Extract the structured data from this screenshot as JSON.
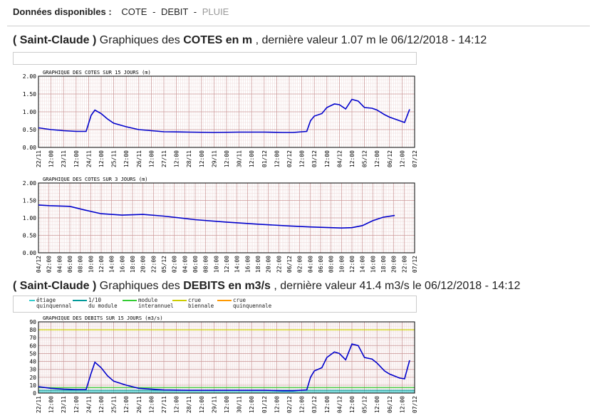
{
  "top": {
    "label": "Données disponibles :",
    "links": [
      {
        "text": "COTE",
        "enabled": true
      },
      {
        "text": "DEBIT",
        "enabled": true
      },
      {
        "text": "PLUIE",
        "enabled": false
      }
    ],
    "separator": "-"
  },
  "section_cotes": {
    "station": "( Saint-Claude )",
    "prefix": "Graphiques des",
    "measure": "COTES en m",
    "suffix": ", dernière valeur 1.07 m le 06/12/2018 - 14:12"
  },
  "section_debits": {
    "station": "( Saint-Claude )",
    "prefix": "Graphiques des",
    "measure": "DEBITS en m3/s",
    "suffix": ", dernière valeur 41.4 m3/s le 06/12/2018 - 14:12"
  },
  "debit_legend": [
    {
      "line1": "étiage",
      "line2": "quinquennal",
      "color": "#33cccc"
    },
    {
      "line1": "1/10",
      "line2": "du module",
      "color": "#009999"
    },
    {
      "line1": "module",
      "line2": "interannuel",
      "color": "#33cc33"
    },
    {
      "line1": "crue",
      "line2": "biennale",
      "color": "#cccc00"
    },
    {
      "line1": "crue",
      "line2": "quinquennale",
      "color": "#ff9900"
    }
  ],
  "colors": {
    "series": "#0000cc",
    "grid_major": "#cc9999",
    "grid_minor": "#f0dede",
    "frame": "#000000"
  },
  "chart_data": [
    {
      "type": "line",
      "title": "GRAPHIQUE DES COTES SUR 15 JOURS (m)",
      "ylim": [
        0,
        2
      ],
      "yticks": [
        "0.00",
        "0.50",
        "1.00",
        "1.50",
        "2.00"
      ],
      "xticks": [
        "22/11",
        "12:00",
        "23/11",
        "12:00",
        "24/11",
        "12:00",
        "25/11",
        "12:00",
        "26/11",
        "12:00",
        "27/11",
        "12:00",
        "28/11",
        "12:00",
        "29/11",
        "12:00",
        "30/11",
        "12:00",
        "01/12",
        "12:00",
        "02/12",
        "12:00",
        "03/12",
        "12:00",
        "04/12",
        "12:00",
        "05/12",
        "12:00",
        "06/12",
        "12:00",
        "07/12"
      ],
      "xlim": [
        0,
        30
      ],
      "series": [
        {
          "x": [
            0,
            1,
            2,
            3,
            3.8,
            4.2,
            4.5,
            5,
            5.5,
            6,
            7,
            8,
            9,
            10,
            12,
            14,
            16,
            18,
            19.5,
            20.3,
            21.4,
            21.7,
            22,
            22.6,
            23,
            23.6,
            24,
            24.5,
            25,
            25.5,
            26,
            26.6,
            27,
            27.6,
            28,
            28.8,
            29.2,
            29.6
          ],
          "y": [
            0.55,
            0.5,
            0.47,
            0.45,
            0.45,
            0.9,
            1.05,
            0.95,
            0.8,
            0.68,
            0.58,
            0.5,
            0.47,
            0.44,
            0.43,
            0.42,
            0.43,
            0.43,
            0.42,
            0.42,
            0.45,
            0.75,
            0.88,
            0.95,
            1.12,
            1.22,
            1.2,
            1.08,
            1.35,
            1.3,
            1.12,
            1.1,
            1.05,
            0.92,
            0.85,
            0.75,
            0.7,
            1.07
          ]
        }
      ]
    },
    {
      "type": "line",
      "title": "GRAPHIQUE DES COTES SUR 3 JOURS (m)",
      "ylim": [
        0,
        2
      ],
      "yticks": [
        "0.00",
        "0.50",
        "1.00",
        "1.50",
        "2.00"
      ],
      "xticks": [
        "04/12",
        "02:00",
        "04:00",
        "06:00",
        "08:00",
        "10:00",
        "12:00",
        "14:00",
        "16:00",
        "18:00",
        "20:00",
        "22:00",
        "05/12",
        "02:00",
        "04:00",
        "06:00",
        "08:00",
        "10:00",
        "12:00",
        "14:00",
        "16:00",
        "18:00",
        "20:00",
        "22:00",
        "06/12",
        "02:00",
        "04:00",
        "06:00",
        "08:00",
        "10:00",
        "12:00",
        "14:00",
        "16:00",
        "18:00",
        "20:00",
        "22:00",
        "07/12"
      ],
      "xlim": [
        0,
        72
      ],
      "series": [
        {
          "x": [
            0,
            2,
            6,
            9,
            12,
            16,
            20,
            24,
            30,
            36,
            42,
            48,
            52,
            56,
            58,
            60,
            62,
            64,
            66,
            68.2
          ],
          "y": [
            1.37,
            1.35,
            1.33,
            1.22,
            1.12,
            1.08,
            1.1,
            1.05,
            0.95,
            0.88,
            0.82,
            0.77,
            0.74,
            0.72,
            0.71,
            0.72,
            0.78,
            0.92,
            1.02,
            1.07
          ]
        }
      ]
    },
    {
      "type": "line",
      "title": "GRAPHIQUE DES DEBITS SUR 15 JOURS (m3/s)",
      "ylim": [
        0,
        90
      ],
      "yticks": [
        "0",
        "10",
        "20",
        "30",
        "40",
        "50",
        "60",
        "70",
        "80",
        "90"
      ],
      "xticks": [
        "22/11",
        "12:00",
        "23/11",
        "12:00",
        "24/11",
        "12:00",
        "25/11",
        "12:00",
        "26/11",
        "12:00",
        "27/11",
        "12:00",
        "28/11",
        "12:00",
        "29/11",
        "12:00",
        "30/11",
        "12:00",
        "01/12",
        "12:00",
        "02/12",
        "12:00",
        "03/12",
        "12:00",
        "04/12",
        "12:00",
        "05/12",
        "12:00",
        "06/12",
        "12:00",
        "07/12"
      ],
      "xlim": [
        0,
        30
      ],
      "thresholds": [
        {
          "value": 80,
          "color": "#cccc00"
        },
        {
          "value": 7,
          "color": "#33cc33"
        },
        {
          "value": 3.5,
          "color": "#009999"
        },
        {
          "value": 1.5,
          "color": "#33cccc"
        }
      ],
      "series": [
        {
          "x": [
            0,
            1,
            2,
            3,
            3.8,
            4.2,
            4.5,
            5,
            5.5,
            6,
            7,
            8,
            9,
            10,
            12,
            14,
            16,
            18,
            19.5,
            20.3,
            21.4,
            21.7,
            22,
            22.6,
            23,
            23.6,
            24,
            24.5,
            25,
            25.5,
            26,
            26.6,
            27,
            27.6,
            28,
            28.8,
            29.2,
            29.6
          ],
          "y": [
            8,
            6,
            5,
            4.5,
            4.5,
            25,
            39,
            32,
            22,
            15,
            10,
            6,
            5,
            4,
            3.5,
            3.5,
            3.5,
            3.5,
            3,
            3,
            4,
            20,
            28,
            32,
            45,
            52,
            50,
            42,
            62,
            60,
            45,
            43,
            38,
            28,
            24,
            19,
            18,
            41.4
          ]
        }
      ]
    }
  ]
}
